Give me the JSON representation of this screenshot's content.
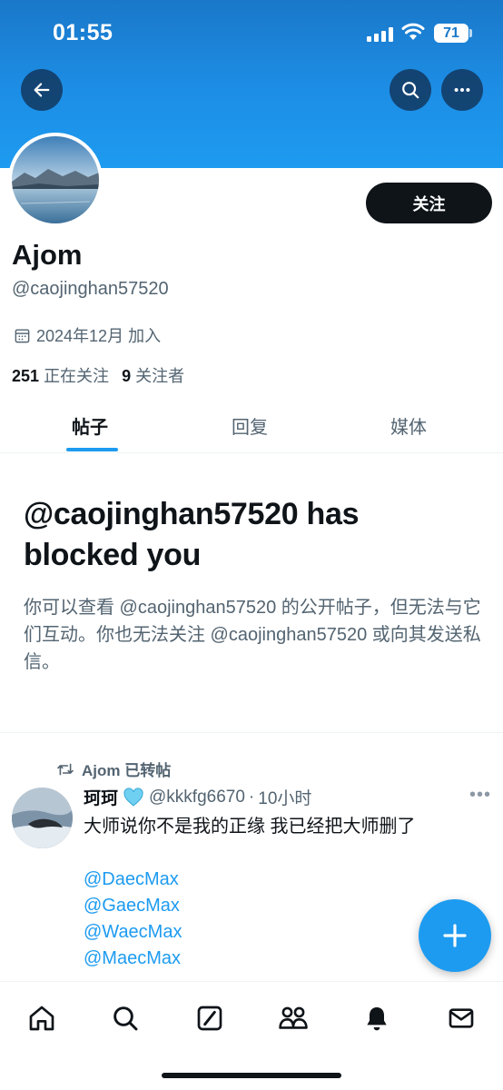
{
  "status_bar": {
    "time": "01:55",
    "battery": "71"
  },
  "top_bar": {
    "back_icon": "arrow-left-icon",
    "search_icon": "search-icon",
    "more_icon": "more-horizontal-icon"
  },
  "profile": {
    "display_name": "Ajom",
    "handle": "@caojinghan57520",
    "joined": "2024年12月 加入",
    "following_count": "251",
    "following_label": "正在关注",
    "followers_count": "9",
    "followers_label": "关注者",
    "follow_button": "关注"
  },
  "tabs": [
    {
      "label": "帖子",
      "active": true
    },
    {
      "label": "回复",
      "active": false
    },
    {
      "label": "媒体",
      "active": false
    }
  ],
  "blocked": {
    "title": "@caojinghan57520 has blocked you",
    "body": "你可以查看 @caojinghan57520 的公开帖子，但无法与它们互动。你也无法关注 @caojinghan57520 或向其发送私信。"
  },
  "tweet": {
    "retweet_label": "Ajom 已转帖",
    "author_name": "珂珂",
    "author_handle": "@kkkfg6670",
    "time": "10小时",
    "text": "大师说你不是我的正缘 我已经把大师删了",
    "mentions": [
      "@DaecMax",
      "@GaecMax",
      "@WaecMax",
      "@MaecMax"
    ]
  },
  "bottom_nav": [
    "home-icon",
    "search-icon",
    "grok-icon",
    "communities-icon",
    "notifications-icon",
    "messages-icon"
  ],
  "colors": {
    "accent": "#1d9bf0",
    "text": "#0f1419",
    "secondary": "#536471"
  }
}
